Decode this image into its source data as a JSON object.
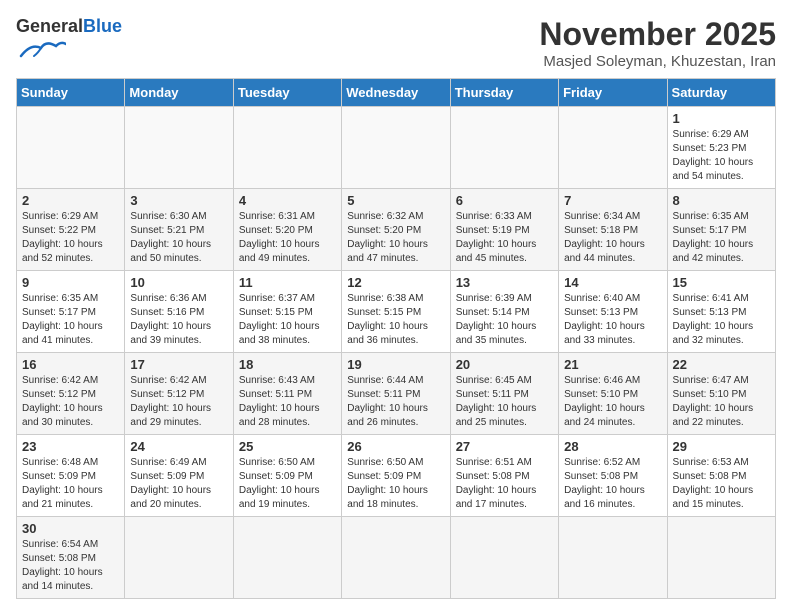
{
  "header": {
    "logo_general": "General",
    "logo_blue": "Blue",
    "month_title": "November 2025",
    "location": "Masjed Soleyman, Khuzestan, Iran"
  },
  "weekdays": [
    "Sunday",
    "Monday",
    "Tuesday",
    "Wednesday",
    "Thursday",
    "Friday",
    "Saturday"
  ],
  "weeks": [
    [
      {
        "day": "",
        "text": ""
      },
      {
        "day": "",
        "text": ""
      },
      {
        "day": "",
        "text": ""
      },
      {
        "day": "",
        "text": ""
      },
      {
        "day": "",
        "text": ""
      },
      {
        "day": "",
        "text": ""
      },
      {
        "day": "1",
        "text": "Sunrise: 6:29 AM\nSunset: 5:23 PM\nDaylight: 10 hours\nand 54 minutes."
      }
    ],
    [
      {
        "day": "2",
        "text": "Sunrise: 6:29 AM\nSunset: 5:22 PM\nDaylight: 10 hours\nand 52 minutes."
      },
      {
        "day": "3",
        "text": "Sunrise: 6:30 AM\nSunset: 5:21 PM\nDaylight: 10 hours\nand 50 minutes."
      },
      {
        "day": "4",
        "text": "Sunrise: 6:31 AM\nSunset: 5:20 PM\nDaylight: 10 hours\nand 49 minutes."
      },
      {
        "day": "5",
        "text": "Sunrise: 6:32 AM\nSunset: 5:20 PM\nDaylight: 10 hours\nand 47 minutes."
      },
      {
        "day": "6",
        "text": "Sunrise: 6:33 AM\nSunset: 5:19 PM\nDaylight: 10 hours\nand 45 minutes."
      },
      {
        "day": "7",
        "text": "Sunrise: 6:34 AM\nSunset: 5:18 PM\nDaylight: 10 hours\nand 44 minutes."
      },
      {
        "day": "8",
        "text": "Sunrise: 6:35 AM\nSunset: 5:17 PM\nDaylight: 10 hours\nand 42 minutes."
      }
    ],
    [
      {
        "day": "9",
        "text": "Sunrise: 6:35 AM\nSunset: 5:17 PM\nDaylight: 10 hours\nand 41 minutes."
      },
      {
        "day": "10",
        "text": "Sunrise: 6:36 AM\nSunset: 5:16 PM\nDaylight: 10 hours\nand 39 minutes."
      },
      {
        "day": "11",
        "text": "Sunrise: 6:37 AM\nSunset: 5:15 PM\nDaylight: 10 hours\nand 38 minutes."
      },
      {
        "day": "12",
        "text": "Sunrise: 6:38 AM\nSunset: 5:15 PM\nDaylight: 10 hours\nand 36 minutes."
      },
      {
        "day": "13",
        "text": "Sunrise: 6:39 AM\nSunset: 5:14 PM\nDaylight: 10 hours\nand 35 minutes."
      },
      {
        "day": "14",
        "text": "Sunrise: 6:40 AM\nSunset: 5:13 PM\nDaylight: 10 hours\nand 33 minutes."
      },
      {
        "day": "15",
        "text": "Sunrise: 6:41 AM\nSunset: 5:13 PM\nDaylight: 10 hours\nand 32 minutes."
      }
    ],
    [
      {
        "day": "16",
        "text": "Sunrise: 6:42 AM\nSunset: 5:12 PM\nDaylight: 10 hours\nand 30 minutes."
      },
      {
        "day": "17",
        "text": "Sunrise: 6:42 AM\nSunset: 5:12 PM\nDaylight: 10 hours\nand 29 minutes."
      },
      {
        "day": "18",
        "text": "Sunrise: 6:43 AM\nSunset: 5:11 PM\nDaylight: 10 hours\nand 28 minutes."
      },
      {
        "day": "19",
        "text": "Sunrise: 6:44 AM\nSunset: 5:11 PM\nDaylight: 10 hours\nand 26 minutes."
      },
      {
        "day": "20",
        "text": "Sunrise: 6:45 AM\nSunset: 5:11 PM\nDaylight: 10 hours\nand 25 minutes."
      },
      {
        "day": "21",
        "text": "Sunrise: 6:46 AM\nSunset: 5:10 PM\nDaylight: 10 hours\nand 24 minutes."
      },
      {
        "day": "22",
        "text": "Sunrise: 6:47 AM\nSunset: 5:10 PM\nDaylight: 10 hours\nand 22 minutes."
      }
    ],
    [
      {
        "day": "23",
        "text": "Sunrise: 6:48 AM\nSunset: 5:09 PM\nDaylight: 10 hours\nand 21 minutes."
      },
      {
        "day": "24",
        "text": "Sunrise: 6:49 AM\nSunset: 5:09 PM\nDaylight: 10 hours\nand 20 minutes."
      },
      {
        "day": "25",
        "text": "Sunrise: 6:50 AM\nSunset: 5:09 PM\nDaylight: 10 hours\nand 19 minutes."
      },
      {
        "day": "26",
        "text": "Sunrise: 6:50 AM\nSunset: 5:09 PM\nDaylight: 10 hours\nand 18 minutes."
      },
      {
        "day": "27",
        "text": "Sunrise: 6:51 AM\nSunset: 5:08 PM\nDaylight: 10 hours\nand 17 minutes."
      },
      {
        "day": "28",
        "text": "Sunrise: 6:52 AM\nSunset: 5:08 PM\nDaylight: 10 hours\nand 16 minutes."
      },
      {
        "day": "29",
        "text": "Sunrise: 6:53 AM\nSunset: 5:08 PM\nDaylight: 10 hours\nand 15 minutes."
      }
    ],
    [
      {
        "day": "30",
        "text": "Sunrise: 6:54 AM\nSunset: 5:08 PM\nDaylight: 10 hours\nand 14 minutes."
      },
      {
        "day": "",
        "text": ""
      },
      {
        "day": "",
        "text": ""
      },
      {
        "day": "",
        "text": ""
      },
      {
        "day": "",
        "text": ""
      },
      {
        "day": "",
        "text": ""
      },
      {
        "day": "",
        "text": ""
      }
    ]
  ]
}
